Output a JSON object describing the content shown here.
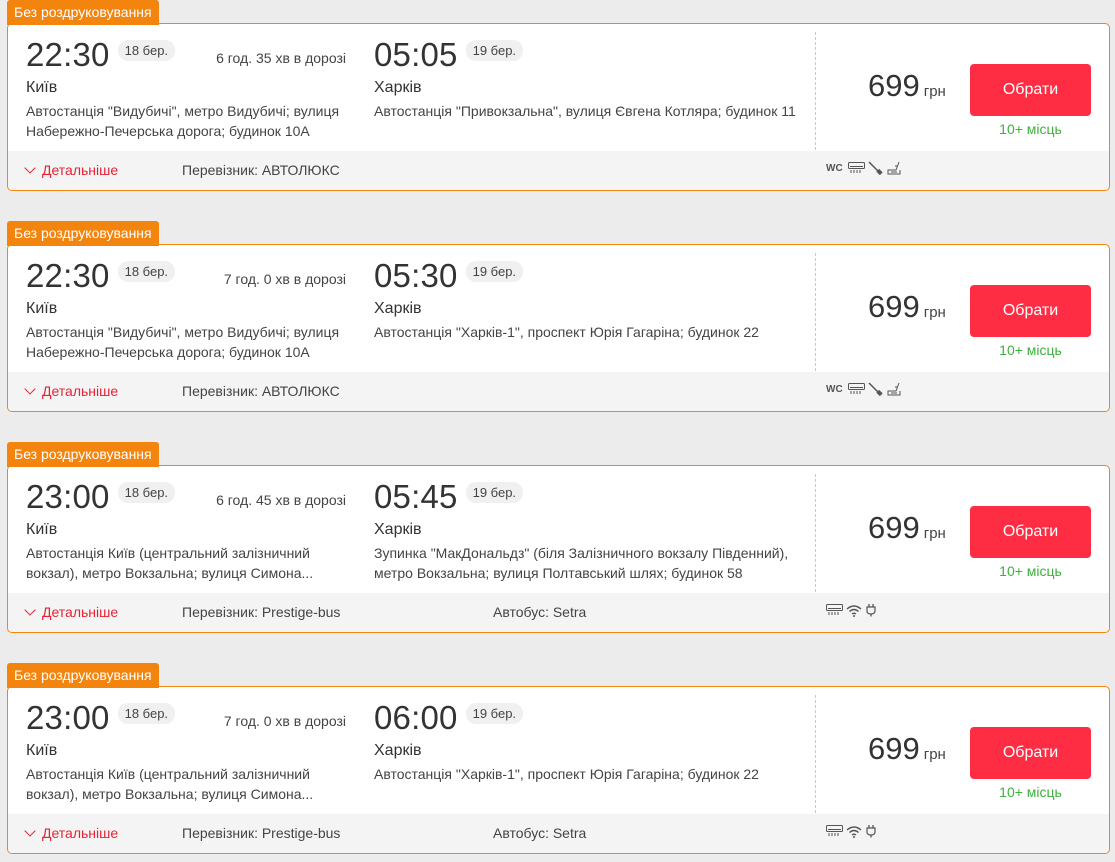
{
  "badge_label": "Без роздруковування",
  "details_label": "Детальніше",
  "select_label": "Обрати",
  "currency": "грн",
  "trips": [
    {
      "dep_time": "22:30",
      "dep_date": "18 бер.",
      "duration": "6 год. 35 хв в дорозі",
      "dep_city": "Київ",
      "dep_addr": "Автостанція \"Видубичі\", метро Видубичі; вулиця Набережно-Печерська дорога; будинок 10А",
      "arr_time": "05:05",
      "arr_date": "19 бер.",
      "arr_city": "Харків",
      "arr_addr": "Автостанція \"Привокзальна\", вулиця Євгена Котляра; будинок 11",
      "price": "699",
      "seats": "10+ місць",
      "carrier": "Перевізник: АВТОЛЮКС",
      "bus": "",
      "amenities": [
        "wc-icon",
        "air-conditioner-icon",
        "lamp-icon",
        "reclining-seat-icon"
      ],
      "wc_text": "WC"
    },
    {
      "dep_time": "22:30",
      "dep_date": "18 бер.",
      "duration": "7 год. 0 хв в дорозі",
      "dep_city": "Київ",
      "dep_addr": "Автостанція \"Видубичі\", метро Видубичі; вулиця Набережно-Печерська дорога; будинок 10А",
      "arr_time": "05:30",
      "arr_date": "19 бер.",
      "arr_city": "Харків",
      "arr_addr": "Автостанція \"Харків-1\", проспект Юрія Гагаріна; будинок 22",
      "price": "699",
      "seats": "10+ місць",
      "carrier": "Перевізник: АВТОЛЮКС",
      "bus": "",
      "amenities": [
        "wc-icon",
        "air-conditioner-icon",
        "lamp-icon",
        "reclining-seat-icon"
      ],
      "wc_text": "WC"
    },
    {
      "dep_time": "23:00",
      "dep_date": "18 бер.",
      "duration": "6 год. 45 хв в дорозі",
      "dep_city": "Київ",
      "dep_addr": "Автостанція Київ (центральний залізничний вокзал), метро Вокзальна; вулиця Симона...",
      "arr_time": "05:45",
      "arr_date": "19 бер.",
      "arr_city": "Харків",
      "arr_addr": "Зупинка \"МакДональдз\" (біля Залізничного вокзалу Південний), метро Вокзальна; вулиця Полтавський шлях; будинок 58",
      "price": "699",
      "seats": "10+ місць",
      "carrier": "Перевізник: Prestige-bus",
      "bus": "Автобус: Setra",
      "amenities": [
        "air-conditioner-icon",
        "wifi-icon",
        "power-socket-icon"
      ],
      "wc_text": ""
    },
    {
      "dep_time": "23:00",
      "dep_date": "18 бер.",
      "duration": "7 год. 0 хв в дорозі",
      "dep_city": "Київ",
      "dep_addr": "Автостанція Київ (центральний залізничний вокзал), метро Вокзальна; вулиця Симона...",
      "arr_time": "06:00",
      "arr_date": "19 бер.",
      "arr_city": "Харків",
      "arr_addr": "Автостанція \"Харків-1\", проспект Юрія Гагаріна; будинок 22",
      "price": "699",
      "seats": "10+ місць",
      "carrier": "Перевізник: Prestige-bus",
      "bus": "Автобус: Setra",
      "amenities": [
        "air-conditioner-icon",
        "wifi-icon",
        "power-socket-icon"
      ],
      "wc_text": ""
    }
  ],
  "colors": {
    "badge": "#f3840d",
    "card_border": "#f3840d",
    "select_button": "#ff2d44",
    "details_link": "#e62335",
    "seats_text": "#3db03d"
  }
}
